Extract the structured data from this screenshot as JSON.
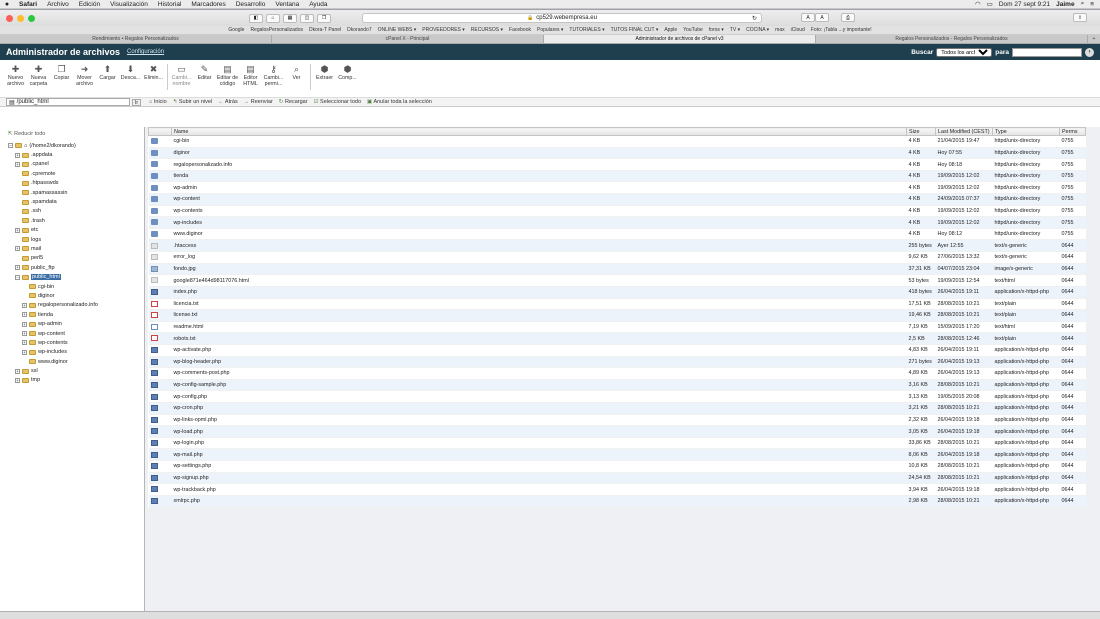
{
  "menubar": {
    "apple": "",
    "items": [
      "Safari",
      "Archivo",
      "Edición",
      "Visualización",
      "Historial",
      "Marcadores",
      "Desarrollo",
      "Ventana",
      "Ayuda"
    ],
    "clock": "Dom 27 sept  9:21",
    "user": "Jaime"
  },
  "browser": {
    "url": "cp529.webempresa.eu",
    "bookmarks": [
      "Google",
      "RegalosPersonalizados",
      "Dkora-T Panel",
      "Dkorando7",
      "ONLINE WEBS ▾",
      "PROVEEDORES ▾",
      "RECURSOS ▾",
      "Facebook",
      "Populares ▾",
      "TUTORIALES ▾",
      "TUTOS FINAL CUT ▾",
      "Apple",
      "YouTube",
      "foros ▾",
      "TV ▾",
      "COCINA ▾",
      "max",
      "iCloud",
      "Foto: ¡Tabla ...y importante!"
    ],
    "tabs": [
      {
        "label": "Rendimiento • Regalos Personalizados",
        "active": false
      },
      {
        "label": "cPanel X - Principal",
        "active": false
      },
      {
        "label": "Administrador de archivos de cPanel v3",
        "active": true
      },
      {
        "label": "Regalos Personalizados - Regalos Personalizados",
        "active": false
      }
    ]
  },
  "header": {
    "title": "Administrador de archivos",
    "config_link": "Configuración",
    "search_label": "Buscar",
    "search_scope": "Todos los archivos",
    "search_for": "para",
    "search_value": ""
  },
  "toolbar": [
    {
      "label": "Nuevo archivo",
      "icon": "new-file-icon",
      "glyph": "✚",
      "dim": false
    },
    {
      "label": "Nueva carpeta",
      "icon": "new-folder-icon",
      "glyph": "✚",
      "dim": false
    },
    {
      "label": "Copiar",
      "icon": "copy-icon",
      "glyph": "❐",
      "dim": false
    },
    {
      "label": "Mover archivo",
      "icon": "move-icon",
      "glyph": "➜",
      "dim": false
    },
    {
      "label": "Cargar",
      "icon": "upload-icon",
      "glyph": "⬆",
      "dim": false
    },
    {
      "label": "Desca...",
      "icon": "download-icon",
      "glyph": "⬇",
      "dim": false
    },
    {
      "label": "Elimin...",
      "icon": "delete-icon",
      "glyph": "✖",
      "dim": false
    },
    {
      "label": "Cambi... nombre",
      "icon": "rename-icon",
      "glyph": "▭",
      "dim": true
    },
    {
      "label": "Editar",
      "icon": "edit-icon",
      "glyph": "✎",
      "dim": false
    },
    {
      "label": "Editar de código",
      "icon": "code-edit-icon",
      "glyph": "▤",
      "dim": false
    },
    {
      "label": "Editor HTML",
      "icon": "html-edit-icon",
      "glyph": "▤",
      "dim": false
    },
    {
      "label": "Cambi... permi...",
      "icon": "permissions-icon",
      "glyph": "⚷",
      "dim": false
    },
    {
      "label": "Ver",
      "icon": "view-icon",
      "glyph": "⌕",
      "dim": false
    },
    {
      "label": "Extraer",
      "icon": "extract-icon",
      "glyph": "⬢",
      "dim": false
    },
    {
      "label": "Comp...",
      "icon": "compress-icon",
      "glyph": "⬢",
      "dim": false
    }
  ],
  "path": {
    "value": "/public_html",
    "go": "Ir"
  },
  "nav": [
    "Inicio",
    "Subir un nivel",
    "Atrás",
    "Reenviar",
    "Recargar",
    "Seleccionar todo",
    "Anular toda la selección"
  ],
  "tree": {
    "collapse_all": "Reducir todo",
    "root": "(/home2/dkorando)",
    "items": [
      {
        "label": ".appdata",
        "level": 1,
        "pm": "+",
        "selected": false
      },
      {
        "label": ".cpanel",
        "level": 1,
        "pm": "+",
        "selected": false
      },
      {
        "label": ".cpremote",
        "level": 1,
        "pm": "",
        "selected": false
      },
      {
        "label": ".htpasswds",
        "level": 1,
        "pm": "",
        "selected": false
      },
      {
        "label": ".spamassassin",
        "level": 1,
        "pm": "",
        "selected": false
      },
      {
        "label": ".spamdata",
        "level": 1,
        "pm": "",
        "selected": false
      },
      {
        "label": ".ssh",
        "level": 1,
        "pm": "",
        "selected": false
      },
      {
        "label": ".trash",
        "level": 1,
        "pm": "",
        "selected": false
      },
      {
        "label": "etc",
        "level": 1,
        "pm": "+",
        "selected": false
      },
      {
        "label": "logs",
        "level": 1,
        "pm": "",
        "selected": false
      },
      {
        "label": "mail",
        "level": 1,
        "pm": "+",
        "selected": false
      },
      {
        "label": "perl5",
        "level": 1,
        "pm": "",
        "selected": false
      },
      {
        "label": "public_ftp",
        "level": 1,
        "pm": "+",
        "selected": false
      },
      {
        "label": "public_html",
        "level": 1,
        "pm": "−",
        "selected": true
      },
      {
        "label": "cgi-bin",
        "level": 2,
        "pm": "",
        "selected": false
      },
      {
        "label": "diginor",
        "level": 2,
        "pm": "",
        "selected": false
      },
      {
        "label": "regalopersonalizado.info",
        "level": 2,
        "pm": "+",
        "selected": false
      },
      {
        "label": "tienda",
        "level": 2,
        "pm": "+",
        "selected": false
      },
      {
        "label": "wp-admin",
        "level": 2,
        "pm": "+",
        "selected": false
      },
      {
        "label": "wp-content",
        "level": 2,
        "pm": "+",
        "selected": false
      },
      {
        "label": "wp-contents",
        "level": 2,
        "pm": "+",
        "selected": false
      },
      {
        "label": "wp-includes",
        "level": 2,
        "pm": "+",
        "selected": false
      },
      {
        "label": "www.diginor",
        "level": 2,
        "pm": "",
        "selected": false
      },
      {
        "label": "ssl",
        "level": 1,
        "pm": "+",
        "selected": false
      },
      {
        "label": "tmp",
        "level": 1,
        "pm": "+",
        "selected": false
      }
    ]
  },
  "table": {
    "headers": {
      "name": "Name",
      "size": "Size",
      "modified": "Last Modified (CEST)",
      "type": "Type",
      "perms": "Perms"
    },
    "rows": [
      {
        "kind": "folder",
        "name": "cgi-bin",
        "size": "4 KB",
        "modified": "21/04/2015 19:47",
        "type": "httpd/unix-directory",
        "perms": "0755"
      },
      {
        "kind": "folder",
        "name": "diginor",
        "size": "4 KB",
        "modified": "Hoy 07:55",
        "type": "httpd/unix-directory",
        "perms": "0755"
      },
      {
        "kind": "folder",
        "name": "regalopersonalizado.info",
        "size": "4 KB",
        "modified": "Hoy 08:18",
        "type": "httpd/unix-directory",
        "perms": "0755"
      },
      {
        "kind": "folder",
        "name": "tienda",
        "size": "4 KB",
        "modified": "19/09/2015 12:02",
        "type": "httpd/unix-directory",
        "perms": "0755"
      },
      {
        "kind": "folder",
        "name": "wp-admin",
        "size": "4 KB",
        "modified": "19/09/2015 12:02",
        "type": "httpd/unix-directory",
        "perms": "0755"
      },
      {
        "kind": "folder",
        "name": "wp-content",
        "size": "4 KB",
        "modified": "24/09/2015 07:37",
        "type": "httpd/unix-directory",
        "perms": "0755"
      },
      {
        "kind": "folder",
        "name": "wp-contents",
        "size": "4 KB",
        "modified": "19/09/2015 12:02",
        "type": "httpd/unix-directory",
        "perms": "0755"
      },
      {
        "kind": "folder",
        "name": "wp-includes",
        "size": "4 KB",
        "modified": "19/09/2015 12:02",
        "type": "httpd/unix-directory",
        "perms": "0755"
      },
      {
        "kind": "folder",
        "name": "www.diginor",
        "size": "4 KB",
        "modified": "Hoy 08:12",
        "type": "httpd/unix-directory",
        "perms": "0755"
      },
      {
        "kind": "file",
        "name": ".htaccess",
        "size": "255 bytes",
        "modified": "Ayer 12:55",
        "type": "text/x-generic",
        "perms": "0644"
      },
      {
        "kind": "file",
        "name": "error_log",
        "size": "9,62 KB",
        "modified": "27/06/2015 13:32",
        "type": "text/x-generic",
        "perms": "0644"
      },
      {
        "kind": "img",
        "name": "fondo.jpg",
        "size": "37,31 KB",
        "modified": "04/07/2015 23:04",
        "type": "image/x-generic",
        "perms": "0644"
      },
      {
        "kind": "file",
        "name": "google871e464d98117076.html",
        "size": "53 bytes",
        "modified": "19/09/2015 12:54",
        "type": "text/html",
        "perms": "0644"
      },
      {
        "kind": "php",
        "name": "index.php",
        "size": "418 bytes",
        "modified": "26/04/2015 19:11",
        "type": "application/x-httpd-php",
        "perms": "0644"
      },
      {
        "kind": "txt",
        "name": "licencia.txt",
        "size": "17,51 KB",
        "modified": "28/08/2015 10:21",
        "type": "text/plain",
        "perms": "0644"
      },
      {
        "kind": "txt",
        "name": "license.txt",
        "size": "19,46 KB",
        "modified": "28/08/2015 10:21",
        "type": "text/plain",
        "perms": "0644"
      },
      {
        "kind": "html",
        "name": "readme.html",
        "size": "7,19 KB",
        "modified": "15/09/2015 17:20",
        "type": "text/html",
        "perms": "0644"
      },
      {
        "kind": "txt",
        "name": "robots.txt",
        "size": "2,5 KB",
        "modified": "28/08/2015 12:46",
        "type": "text/plain",
        "perms": "0644"
      },
      {
        "kind": "php",
        "name": "wp-activate.php",
        "size": "4,83 KB",
        "modified": "26/04/2015 19:11",
        "type": "application/x-httpd-php",
        "perms": "0644"
      },
      {
        "kind": "php",
        "name": "wp-blog-header.php",
        "size": "271 bytes",
        "modified": "26/04/2015 19:13",
        "type": "application/x-httpd-php",
        "perms": "0644"
      },
      {
        "kind": "php",
        "name": "wp-comments-post.php",
        "size": "4,89 KB",
        "modified": "26/04/2015 19:13",
        "type": "application/x-httpd-php",
        "perms": "0644"
      },
      {
        "kind": "php",
        "name": "wp-config-sample.php",
        "size": "3,16 KB",
        "modified": "28/08/2015 10:21",
        "type": "application/x-httpd-php",
        "perms": "0644"
      },
      {
        "kind": "php",
        "name": "wp-config.php",
        "size": "3,13 KB",
        "modified": "19/05/2015 20:08",
        "type": "application/x-httpd-php",
        "perms": "0644"
      },
      {
        "kind": "php",
        "name": "wp-cron.php",
        "size": "3,21 KB",
        "modified": "28/08/2015 10:21",
        "type": "application/x-httpd-php",
        "perms": "0644"
      },
      {
        "kind": "php",
        "name": "wp-links-opml.php",
        "size": "2,32 KB",
        "modified": "26/04/2015 19:18",
        "type": "application/x-httpd-php",
        "perms": "0644"
      },
      {
        "kind": "php",
        "name": "wp-load.php",
        "size": "3,05 KB",
        "modified": "26/04/2015 19:18",
        "type": "application/x-httpd-php",
        "perms": "0644"
      },
      {
        "kind": "php",
        "name": "wp-login.php",
        "size": "33,86 KB",
        "modified": "28/08/2015 10:21",
        "type": "application/x-httpd-php",
        "perms": "0644"
      },
      {
        "kind": "php",
        "name": "wp-mail.php",
        "size": "8,06 KB",
        "modified": "26/04/2015 19:18",
        "type": "application/x-httpd-php",
        "perms": "0644"
      },
      {
        "kind": "php",
        "name": "wp-settings.php",
        "size": "10,8 KB",
        "modified": "28/08/2015 10:21",
        "type": "application/x-httpd-php",
        "perms": "0644"
      },
      {
        "kind": "php",
        "name": "wp-signup.php",
        "size": "24,54 KB",
        "modified": "28/08/2015 10:21",
        "type": "application/x-httpd-php",
        "perms": "0644"
      },
      {
        "kind": "php",
        "name": "wp-trackback.php",
        "size": "3,94 KB",
        "modified": "26/04/2015 19:18",
        "type": "application/x-httpd-php",
        "perms": "0644"
      },
      {
        "kind": "php",
        "name": "xmlrpc.php",
        "size": "2,98 KB",
        "modified": "28/08/2015 10:21",
        "type": "application/x-httpd-php",
        "perms": "0644"
      }
    ]
  },
  "colors": {
    "header_bg": "#1f3f4f",
    "selection": "#3a6ea5",
    "row_alt": "#edf3fb"
  }
}
